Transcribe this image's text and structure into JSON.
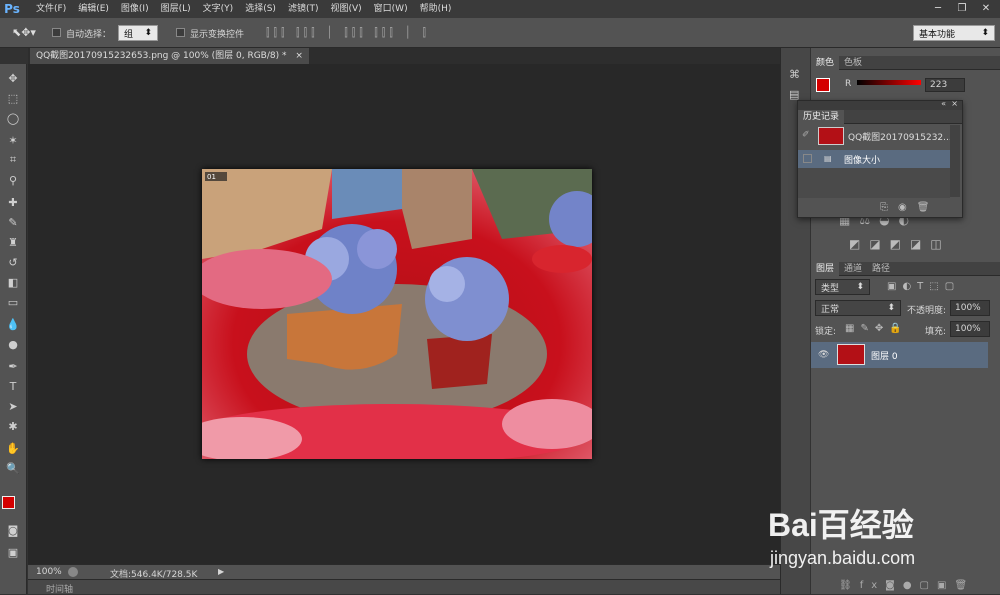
{
  "app": {
    "logo": "Ps",
    "workspace": "基本功能"
  },
  "menu": [
    "文件(F)",
    "编辑(E)",
    "图像(I)",
    "图层(L)",
    "文字(Y)",
    "选择(S)",
    "滤镜(T)",
    "视图(V)",
    "窗口(W)",
    "帮助(H)"
  ],
  "options": {
    "auto_select_label": "自动选择：",
    "auto_select_value": "组",
    "show_transform_label": "显示变换控件"
  },
  "document": {
    "tab_title": "QQ截图20170915232653.png @ 100% (图层 0, RGB/8) *"
  },
  "status": {
    "zoom": "100%",
    "doc_size": "文档:546.4K/728.5K",
    "timeline_label": "时间轴"
  },
  "color_panel": {
    "tabs": [
      "颜色",
      "色板"
    ],
    "channel": "R",
    "value": "223",
    "fg_color": "#d40000"
  },
  "history_panel": {
    "tab": "历史记录",
    "snapshot_label": "QQ截图20170915232...",
    "items": [
      "图像大小"
    ]
  },
  "layers_panel": {
    "tabs": [
      "图层",
      "通道",
      "路径"
    ],
    "filter": "类型",
    "blend_mode": "正常",
    "opacity_label": "不透明度:",
    "opacity": "100%",
    "lock_label": "锁定:",
    "fill_label": "填充:",
    "fill": "100%",
    "layers": [
      {
        "name": "图层 0"
      }
    ]
  },
  "watermark": {
    "brand": "Bai百经验",
    "url": "jingyan.baidu.com"
  },
  "canvas_label": "01"
}
